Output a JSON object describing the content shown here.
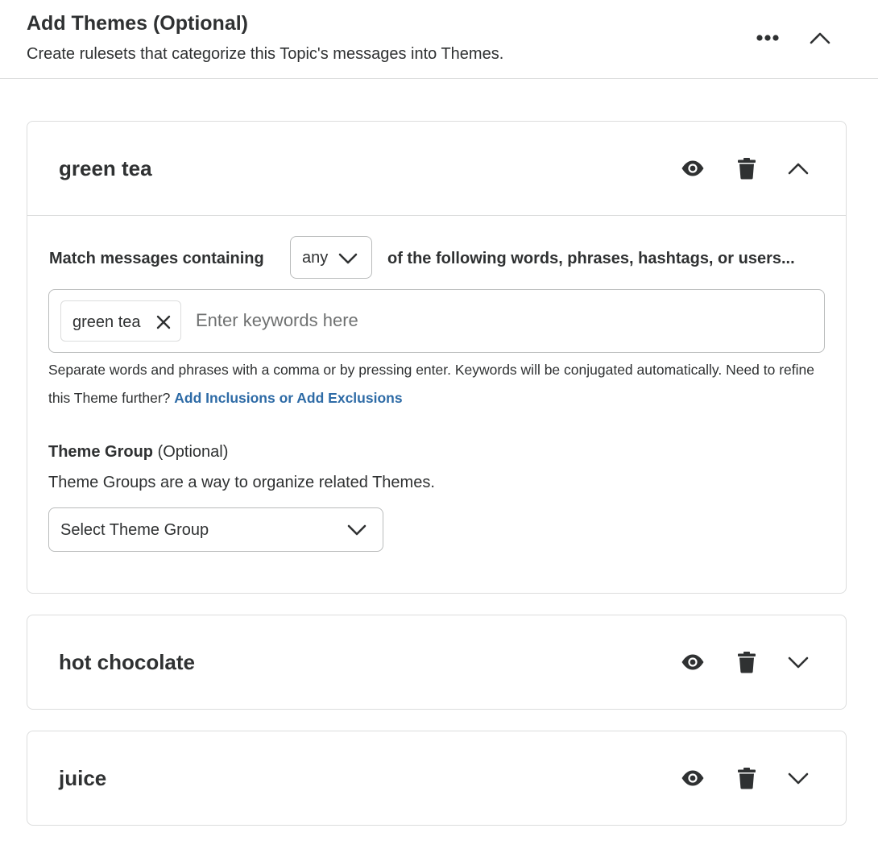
{
  "header": {
    "title": "Add Themes (Optional)",
    "subtitle": "Create rulesets that categorize this Topic's messages into Themes.",
    "more_icon": "more-horizontal-icon",
    "collapse_icon": "chevron-up-icon"
  },
  "themes": [
    {
      "name": "green tea",
      "expanded": true,
      "match": {
        "label": "Match messages containing",
        "mode": "any",
        "tail": "of the following words, phrases, hashtags, or users..."
      },
      "keywords": [
        "green tea"
      ],
      "keyword_placeholder": "Enter keywords here",
      "helper_text": "Separate words and phrases with a comma or by pressing enter. Keywords will be conjugated automatically. Need to refine this Theme further?",
      "helper_link": "Add Inclusions or Add Exclusions",
      "group": {
        "label": "Theme Group",
        "optional": "(Optional)",
        "description": "Theme Groups are a way to organize related Themes.",
        "select_value": "Select Theme Group"
      }
    },
    {
      "name": "hot chocolate",
      "expanded": false
    },
    {
      "name": "juice",
      "expanded": false
    }
  ],
  "icons": {
    "preview": "eye-icon",
    "delete": "trash-icon",
    "expand": "chevron-down-icon",
    "collapse": "chevron-up-icon",
    "remove_chip": "close-icon"
  },
  "colors": {
    "text": "#2f3132",
    "link": "#2e6ba6",
    "border": "#dcdddd",
    "placeholder": "#6f7171"
  }
}
